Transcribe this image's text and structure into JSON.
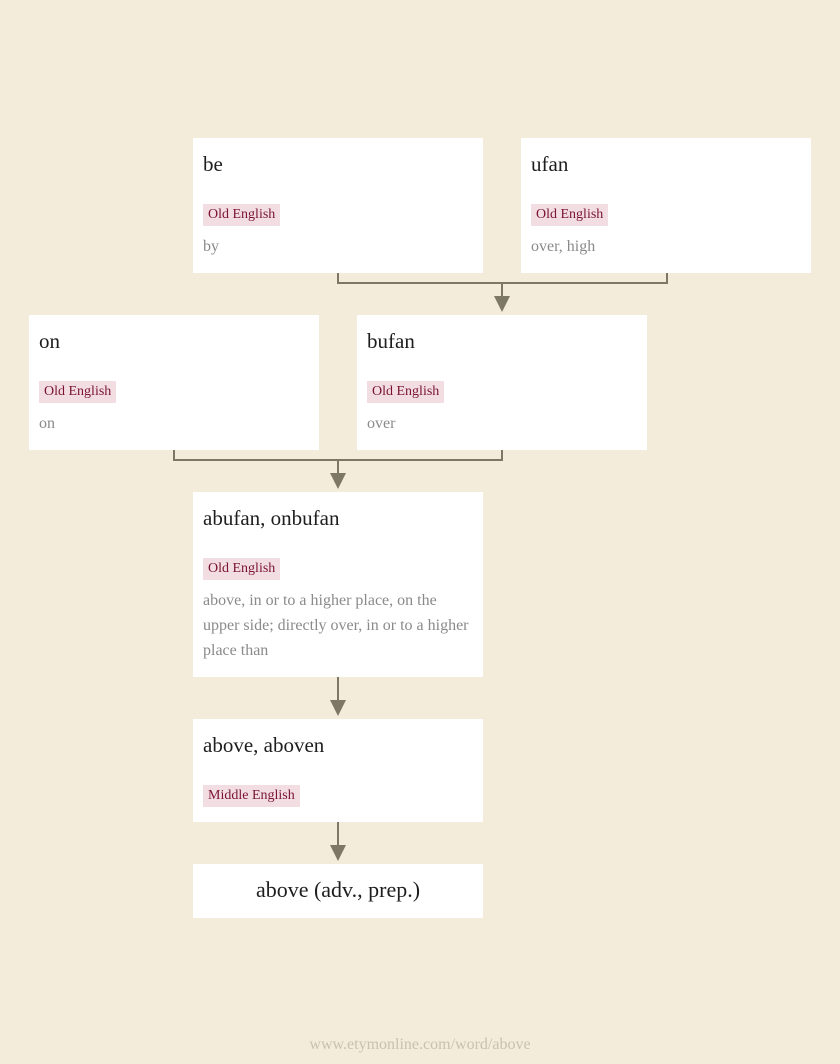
{
  "nodes": {
    "be": {
      "word": "be",
      "language": "Old English",
      "gloss": "by"
    },
    "ufan": {
      "word": "ufan",
      "language": "Old English",
      "gloss": "over, high"
    },
    "on": {
      "word": "on",
      "language": "Old English",
      "gloss": "on"
    },
    "bufan": {
      "word": "bufan",
      "language": "Old English",
      "gloss": "over"
    },
    "abufan": {
      "word": "abufan, onbufan",
      "language": "Old English",
      "gloss": "above, in or to a higher place, on the upper side; directly over, in or to a higher place than"
    },
    "above_me": {
      "word": "above, aboven",
      "language": "Middle English"
    },
    "final": {
      "word": "above (adv., prep.)"
    }
  },
  "colors": {
    "background": "#f3ecdb",
    "connector": "#7d7866",
    "language_badge_bg": "#f2dde2",
    "language_badge_text": "#7a1430"
  },
  "footer": {
    "url": "www.etymonline.com/word/above"
  }
}
